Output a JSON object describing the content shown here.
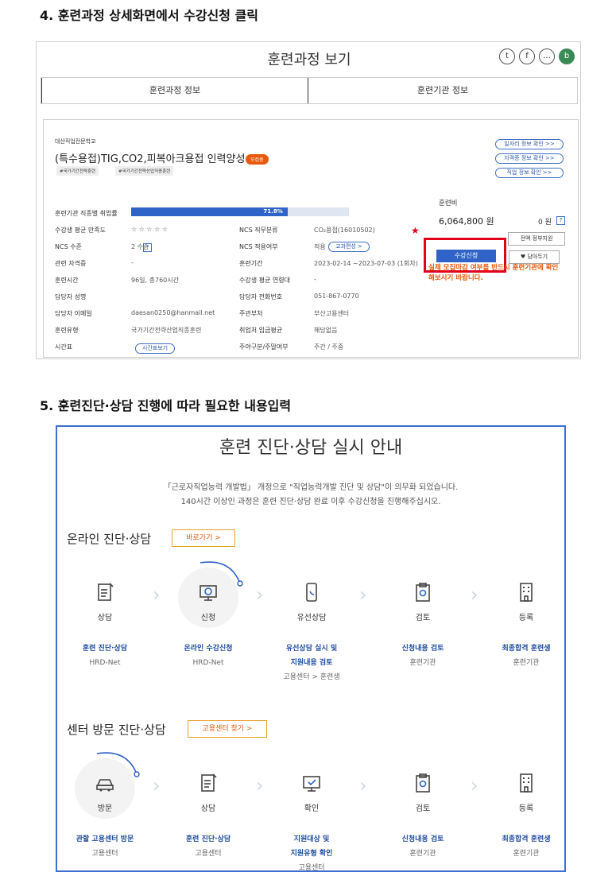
{
  "step4": {
    "title": "4. 훈련과정 상세화면에서 수강신청 클릭"
  },
  "step5": {
    "title": "5. 훈련진단·상담 진행에 따라 필요한 내용입력"
  },
  "panel1": {
    "title": "훈련과정 보기",
    "tabs": [
      "훈련과정 정보",
      "훈련기관 정보"
    ],
    "institution": "대산직업전문학교",
    "course_title": "(특수용접)TIG,CO2,피복아크용접 인력양성",
    "status_badge": "모집중",
    "tags": [
      "#국가기간전략훈련",
      "#국가기간전략산업직종훈련"
    ],
    "side_links": [
      "일자리 정보 확인 >>",
      "자격증 정보 확인 >>",
      "직업 정보 확인 >>"
    ],
    "employment": {
      "label": "훈련기관 직종별 취업률",
      "value_text": "71.8%",
      "value": 0.718
    },
    "rows": [
      {
        "l1": "수강생 평균 만족도",
        "v1": "☆ ☆ ☆ ☆ ☆",
        "l2": "NCS 직무분류",
        "v2": "CO₂용접(16010502)"
      },
      {
        "l1": "NCS 수준",
        "v1": "2 수준",
        "l2": "NCS 적용여부",
        "v2": "적용"
      },
      {
        "l1": "관련 자격증",
        "v1": "-",
        "l2": "훈련기간",
        "v2": "2023-02-14 ~2023-07-03 (1회차)"
      },
      {
        "l1": "훈련시간",
        "v1": "96일, 총760시간",
        "l2": "수강생 평균 연령대",
        "v2": "-"
      },
      {
        "l1": "담당자 성명",
        "v1": "",
        "l2": "담당자 전화번호",
        "v2": "051-867-0770"
      },
      {
        "l1": "담당자 이메일",
        "v1": "daesan0250@hanmail.net",
        "l2": "주관부처",
        "v2": "부산고용센터"
      },
      {
        "l1": "훈련유형",
        "v1": "국가기간전략산업직종훈련",
        "l2": "취업처 임금평균",
        "v2": "해당없음"
      },
      {
        "l1": "시간표",
        "v1": "",
        "l2": "주야구분/주말여부",
        "v2": "주간 / 주중"
      }
    ],
    "ncs_help": "?",
    "curriculum_btn": "교과편성 >",
    "timetable_btn": "시간표보기",
    "fee_label": "훈련비",
    "fee_value": "6,064,800 원",
    "self_pay": "0 원",
    "self_pay_help": "?",
    "full_support_btn": "전액 정부지원",
    "apply_btn": "수강신청",
    "wish_btn": "♥ 담아두기",
    "notice": "실제 모집마감 여부를 반드시 훈련기관에 확인해보시기 바랍니다.",
    "star": "★"
  },
  "panel2": {
    "title": "훈련 진단·상담 실시 안내",
    "desc1": "「근로자직업능력 개발법」 개정으로 \"직업능력개발 진단 및 상담\"이 의무화 되었습니다.",
    "desc2": "140시간 이상인 과정은 훈련 진단·상담 완료 이후 수강신청을 진행해주십시오.",
    "online": {
      "title": "온라인 진단·상담",
      "button": "바로가기 >",
      "steps": [
        {
          "icon": "document-edit-icon",
          "label": "상담",
          "sub": [
            "훈련 진단·상담"
          ],
          "sub2": [
            "HRD-Net"
          ]
        },
        {
          "icon": "monitor-plus-icon",
          "label": "신청",
          "sub": [
            "온라인 수강신청"
          ],
          "sub2": [
            "HRD-Net"
          ]
        },
        {
          "icon": "phone-icon",
          "label": "유선상담",
          "sub": [
            "유선상담 실시 및",
            "지원내용 검토"
          ],
          "sub2": [
            "고용센터 > 훈련생"
          ]
        },
        {
          "icon": "clipboard-check-icon",
          "label": "검토",
          "sub": [
            "신청내용 검토"
          ],
          "sub2": [
            "훈련기관"
          ]
        },
        {
          "icon": "building-icon",
          "label": "등록",
          "sub": [
            "최종합격 훈련생"
          ],
          "sub2": [
            "훈련기관"
          ]
        }
      ]
    },
    "visit": {
      "title": "센터 방문 진단·상담",
      "button": "고용센터 찾기 >",
      "steps": [
        {
          "icon": "car-icon",
          "label": "방문",
          "sub": [
            "관할 고용센터 방문"
          ],
          "sub2": [
            "고용센터"
          ]
        },
        {
          "icon": "document-edit-icon",
          "label": "상담",
          "sub": [
            "훈련 진단·상담"
          ],
          "sub2": [
            "고용센터"
          ]
        },
        {
          "icon": "monitor-check-icon",
          "label": "확인",
          "sub": [
            "지원대상 및",
            "지원유형 확인"
          ],
          "sub2": [
            "고용센터"
          ]
        },
        {
          "icon": "clipboard-check-icon",
          "label": "검토",
          "sub": [
            "신청내용 검토"
          ],
          "sub2": [
            "훈련기관"
          ]
        },
        {
          "icon": "building-icon",
          "label": "등록",
          "sub": [
            "최종합격 훈련생"
          ],
          "sub2": [
            "훈련기관"
          ]
        }
      ]
    }
  }
}
